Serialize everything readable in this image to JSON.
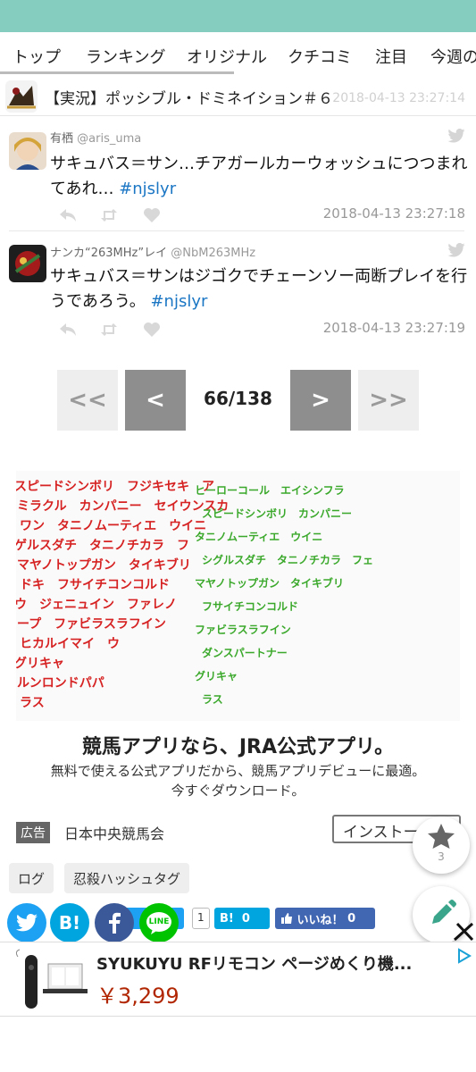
{
  "nav": {
    "items": [
      "トップ",
      "ランキング",
      "オリジナル",
      "クチコミ",
      "注目",
      "今週の"
    ]
  },
  "thread": {
    "title": "【実況】ポッシブル・ドミネイション＃６",
    "date": "2018-04-13 23:27:14"
  },
  "tweets": [
    {
      "name": "有栖",
      "handle": "@aris_uma",
      "text": "サキュバス＝サン…チアガールカーウォッシュにつつまれてあれ… ",
      "hashtag": "#njslyr",
      "date": "2018-04-13 23:27:18"
    },
    {
      "name": "ナンカ“263MHz”レイ",
      "handle": "@NbM263MHz",
      "text": "サキュバス＝サンはジゴクでチェーンソー両断プレイを行うであろう。 ",
      "hashtag": "#njslyr",
      "date": "2018-04-13 23:27:19"
    }
  ],
  "pager": {
    "first": "<<",
    "prev": "<",
    "current": "66/138",
    "next": ">",
    "last": ">>"
  },
  "ad": {
    "title": "競馬アプリなら、JRA公式アプリ。",
    "desc_line1": "無料で使える公式アプリだから、競馬アプリデビューに最適。",
    "desc_line2": "今すぐダウンロード。",
    "tag": "広告",
    "sponsor": "日本中央競馬会",
    "install": "インストール",
    "image_text_red": [
      "スピードシンボリ　フジキセキ　ア",
      "ミラクル　カンパニー　セイウンスカ",
      "ワン　タニノムーティエ　ウイニ",
      "ゲルスダチ　タニノチカラ　フ",
      "マヤノトップガン　タイキブリ",
      "ドキ　フサイチコンコルド",
      "ウ　ジェニュイン　ファレノ",
      "ープ　ファビラスラフイン",
      "ヒカルイマイ　ウ",
      "グリキャ",
      "ルンロンドパパ",
      "ラス"
    ],
    "image_text_green": [
      "ヒーローコール　エイシンフラ",
      "スピードシンボリ　カンパニー",
      "タニノムーティエ　ウイニ",
      "シグルスダチ　タニノチカラ　フェ",
      "マヤノトップガン　タイキブリ",
      "フサイチコンコルド",
      "ファビラスラフイン",
      "ダンスパートナー",
      "グリキャ",
      "ラス"
    ]
  },
  "tags": [
    "ログ",
    "忍殺ハッシュタグ"
  ],
  "share": {
    "twitter_count": "1",
    "hatena_label": "B!",
    "hatena_count": "0",
    "like_label": "いいね！",
    "like_count": "0",
    "line_label": "LINE"
  },
  "fab": {
    "favorites_count": "3"
  },
  "bottom_ad": {
    "title": "SYUKUYU RFリモコン ページめくり機...",
    "price": "￥3,299"
  },
  "colors": {
    "topbar": "#84cdbf",
    "hashtag": "#1b76c4",
    "twitter": "#1da1f2",
    "hatena": "#00a4de",
    "facebook": "#3b5998",
    "line": "#00c300",
    "price": "#b12704"
  }
}
